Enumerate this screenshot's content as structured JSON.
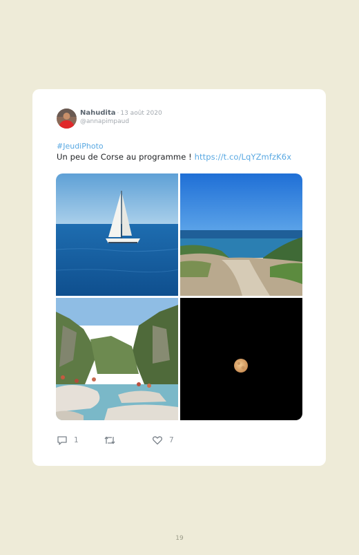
{
  "tweet": {
    "author_name": "Nahudita",
    "separator": "·",
    "date": "13 août 2020",
    "handle": "@annapimpaud",
    "hashtag": "#JeudiPhoto",
    "text": "Un peu de Corse au programme !",
    "link": "https://t.co/LqYZmfzK6x",
    "photos": [
      "sailboat-sea-photo",
      "coast-path-photo",
      "river-gorge-photo",
      "moon-night-photo"
    ],
    "reply_count": "1",
    "like_count": "7"
  },
  "page": {
    "number": "19"
  },
  "colors": {
    "background": "#eeebd8",
    "card": "#ffffff",
    "link": "#58a8e2",
    "muted": "#a3a9af"
  }
}
